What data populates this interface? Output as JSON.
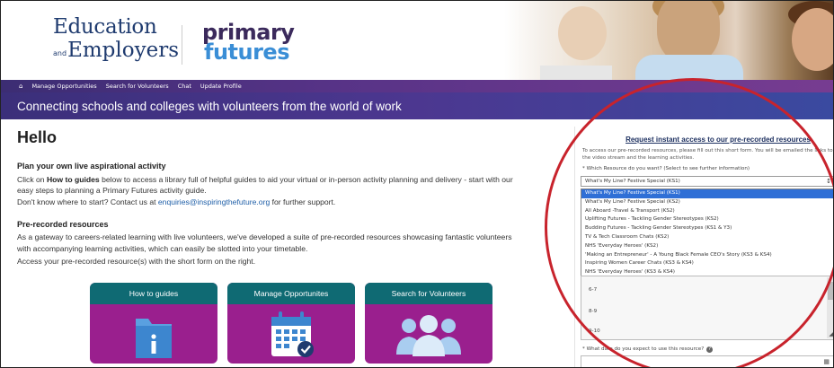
{
  "brand": {
    "ee_line1": "Education",
    "ee_and": "and",
    "ee_line2": "Employers",
    "pf_line1": "primary",
    "pf_line2": "futures"
  },
  "nav": {
    "home_icon": "home-icon",
    "items": [
      "Manage Opportunities",
      "Search for Volunteers",
      "Chat",
      "Update Profile"
    ]
  },
  "banner": "Connecting schools and colleges with volunteers from the world of work",
  "main": {
    "greeting": "Hello",
    "plan": {
      "heading": "Plan your own live aspirational activity",
      "line1_pre": "Click on ",
      "line1_bold": "How to guides",
      "line1_post": " below to access a library full of helpful guides to aid your virtual or in-person activity planning and delivery - start with our",
      "line2": "easy steps to planning a Primary Futures activity guide.",
      "line3_pre": "Don't know where to start? Contact us at ",
      "line3_link": "enquiries@inspiringthefuture.org",
      "line3_post": " for further support."
    },
    "prerec": {
      "heading": "Pre-recorded resources",
      "line1": "As a gateway to careers-related learning with live volunteers, we've developed a suite of pre-recorded resources showcasing fantastic volunteers",
      "line2": "with accompanying learning activities, which can easily be slotted into your timetable.",
      "line3": "Access your pre-recorded resource(s) with the short form on the right."
    },
    "tiles": [
      {
        "label": "How to guides",
        "icon": "folder-info-icon"
      },
      {
        "label": "Manage Opportunites",
        "icon": "calendar-check-icon"
      },
      {
        "label": "Search for Volunteers",
        "icon": "people-icon"
      }
    ]
  },
  "form": {
    "title": "Request instant access to our pre-recorded resources",
    "description": "To access our pre-recorded resources, please fill out this short form. You will be emailed the links to the video stream and the learning activities.",
    "q1_label": "* Which Resource do you want? (Select to see further information)",
    "q1_value": "What's My Line? Festive Special (KS1)",
    "options": [
      "What's My Line? Festive Special (KS1)",
      "What's My Line? Festive Special (KS2)",
      "All Aboard -Travel & Transport (KS2)",
      "Uplifting Futures - Tackling Gender Stereotypes (KS2)",
      "Budding Futures - Tackling Gender Stereotypes (KS1 & Y3)",
      "TV & Tech Classroom Chats (KS2)",
      "NHS 'Everyday Heroes' (KS2)",
      "'Making an Entrepreneur' - A Young Black Female CEO's Story (KS3 & KS4)",
      "Inspiring Women Career Chats (KS3 & KS4)",
      "NHS 'Everyday Heroes' (KS3 & KS4)"
    ],
    "age_options": [
      "6-7",
      "8-9",
      "9-10"
    ],
    "q2_label": "* What date do you expect to use this resource?",
    "q2_help": "?"
  },
  "colors": {
    "nav_purple": "#573387",
    "banner_purple": "#4c3790",
    "tile_magenta": "#9a1f8e",
    "tile_teal": "#0f6a73",
    "annotation_red": "#c8232c"
  }
}
